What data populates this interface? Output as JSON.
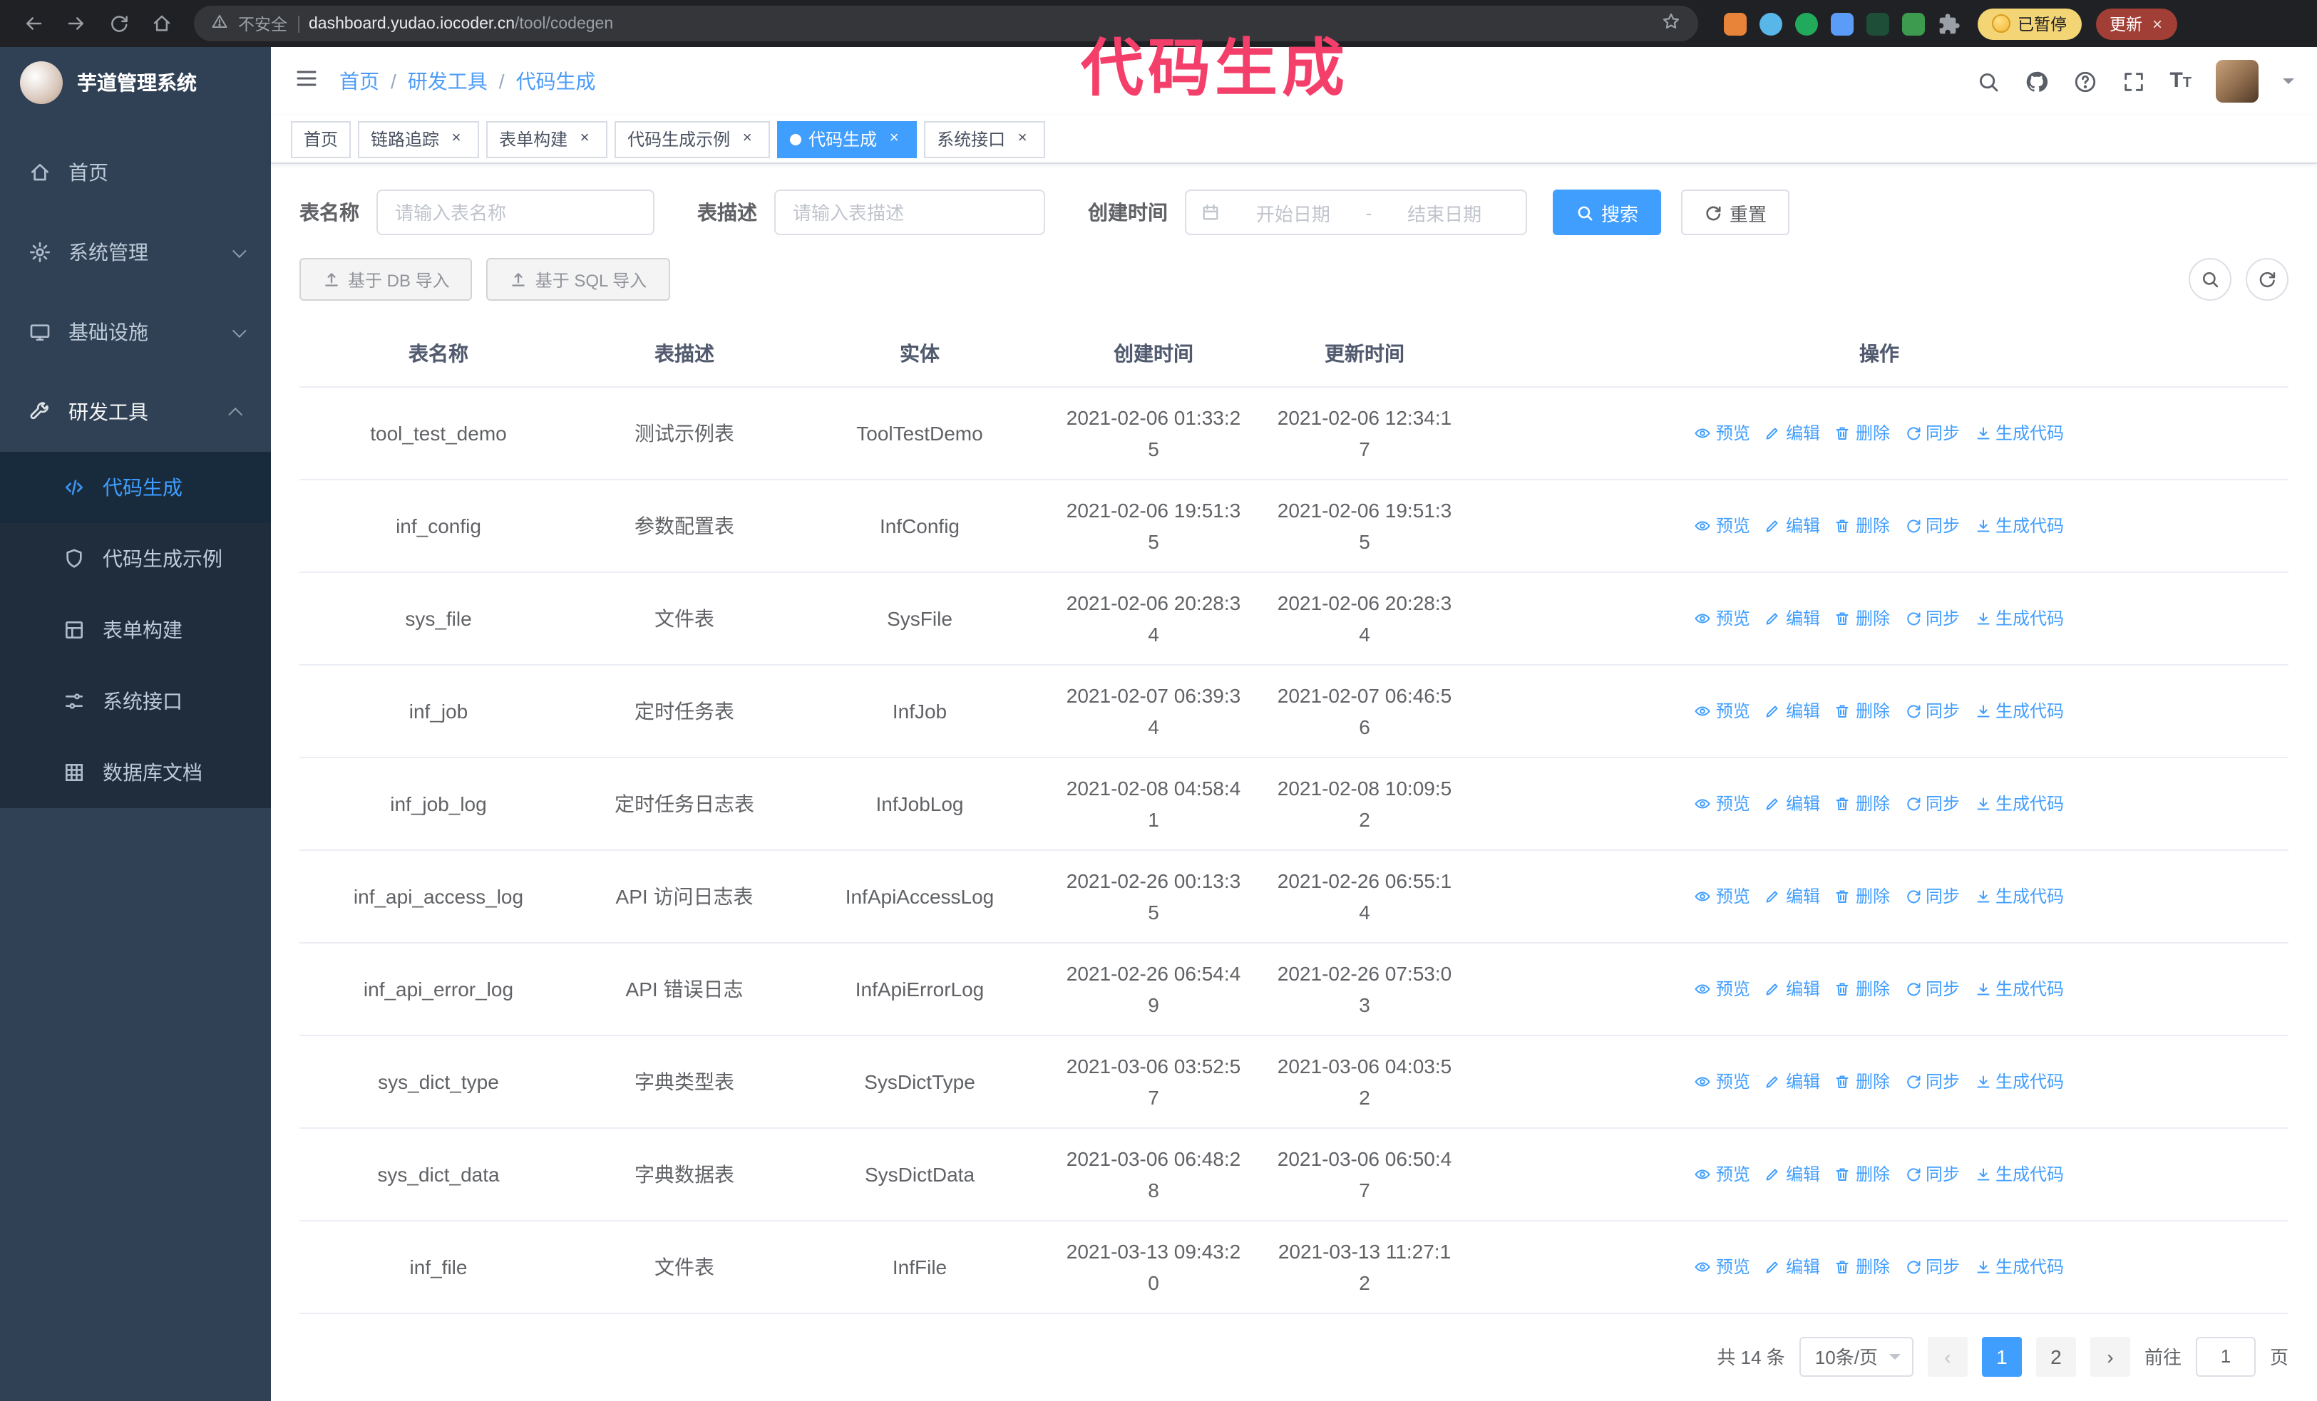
{
  "colors": {
    "accent": "#409eff",
    "annotation": "#f43f6a",
    "sidebar_bg": "#304156",
    "submenu_bg": "#1f2d3d"
  },
  "icons": {
    "close": "×",
    "prev": "‹",
    "next": "›",
    "font_size_large": "T",
    "font_size_small": "T"
  },
  "annotation": {
    "text": "代码生成"
  },
  "browser": {
    "security_label": "不安全",
    "url_host": "dashboard.yudao.iocoder.cn",
    "url_path": "/tool/codegen",
    "paused_badge": "已暂停",
    "update_button": "更新"
  },
  "sidebar": {
    "logo_title": "芋道管理系统",
    "items": [
      {
        "label": "首页"
      },
      {
        "label": "系统管理"
      },
      {
        "label": "基础设施"
      },
      {
        "label": "研发工具"
      }
    ],
    "dev_submenu": [
      {
        "label": "代码生成",
        "active": true
      },
      {
        "label": "代码生成示例"
      },
      {
        "label": "表单构建"
      },
      {
        "label": "系统接口"
      },
      {
        "label": "数据库文档"
      }
    ]
  },
  "header": {
    "breadcrumb": [
      "首页",
      "研发工具",
      "代码生成"
    ],
    "separator": "/"
  },
  "tags": [
    {
      "label": "首页",
      "closable": false,
      "active": false
    },
    {
      "label": "链路追踪",
      "closable": true,
      "active": false
    },
    {
      "label": "表单构建",
      "closable": true,
      "active": false
    },
    {
      "label": "代码生成示例",
      "closable": true,
      "active": false
    },
    {
      "label": "代码生成",
      "closable": true,
      "active": true
    },
    {
      "label": "系统接口",
      "closable": true,
      "active": false
    }
  ],
  "filters": {
    "name_label": "表名称",
    "name_placeholder": "请输入表名称",
    "desc_label": "表描述",
    "desc_placeholder": "请输入表描述",
    "time_label": "创建时间",
    "start_placeholder": "开始日期",
    "range_separator": "-",
    "end_placeholder": "结束日期",
    "search_label": "搜索",
    "reset_label": "重置"
  },
  "toolbar": {
    "import_db": "基于 DB 导入",
    "import_sql": "基于 SQL 导入"
  },
  "table": {
    "columns": [
      "表名称",
      "表描述",
      "实体",
      "创建时间",
      "更新时间",
      "操作"
    ],
    "actions": {
      "preview": "预览",
      "edit": "编辑",
      "delete": "删除",
      "sync": "同步",
      "generate": "生成代码"
    },
    "rows": [
      {
        "name": "tool_test_demo",
        "desc": "测试示例表",
        "entity": "ToolTestDemo",
        "created": "2021-02-06 01:33:25",
        "updated": "2021-02-06 12:34:17"
      },
      {
        "name": "inf_config",
        "desc": "参数配置表",
        "entity": "InfConfig",
        "created": "2021-02-06 19:51:35",
        "updated": "2021-02-06 19:51:35"
      },
      {
        "name": "sys_file",
        "desc": "文件表",
        "entity": "SysFile",
        "created": "2021-02-06 20:28:34",
        "updated": "2021-02-06 20:28:34"
      },
      {
        "name": "inf_job",
        "desc": "定时任务表",
        "entity": "InfJob",
        "created": "2021-02-07 06:39:34",
        "updated": "2021-02-07 06:46:56"
      },
      {
        "name": "inf_job_log",
        "desc": "定时任务日志表",
        "entity": "InfJobLog",
        "created": "2021-02-08 04:58:41",
        "updated": "2021-02-08 10:09:52"
      },
      {
        "name": "inf_api_access_log",
        "desc": "API 访问日志表",
        "entity": "InfApiAccessLog",
        "created": "2021-02-26 00:13:35",
        "updated": "2021-02-26 06:55:14"
      },
      {
        "name": "inf_api_error_log",
        "desc": "API 错误日志",
        "entity": "InfApiErrorLog",
        "created": "2021-02-26 06:54:49",
        "updated": "2021-02-26 07:53:03"
      },
      {
        "name": "sys_dict_type",
        "desc": "字典类型表",
        "entity": "SysDictType",
        "created": "2021-03-06 03:52:57",
        "updated": "2021-03-06 04:03:52"
      },
      {
        "name": "sys_dict_data",
        "desc": "字典数据表",
        "entity": "SysDictData",
        "created": "2021-03-06 06:48:28",
        "updated": "2021-03-06 06:50:47"
      },
      {
        "name": "inf_file",
        "desc": "文件表",
        "entity": "InfFile",
        "created": "2021-03-13 09:43:20",
        "updated": "2021-03-13 11:27:12"
      }
    ]
  },
  "pagination": {
    "total": "共 14 条",
    "page_size": "10条/页",
    "pages": [
      "1",
      "2"
    ],
    "goto_label": "前往",
    "goto_value": "1",
    "unit_label": "页"
  }
}
